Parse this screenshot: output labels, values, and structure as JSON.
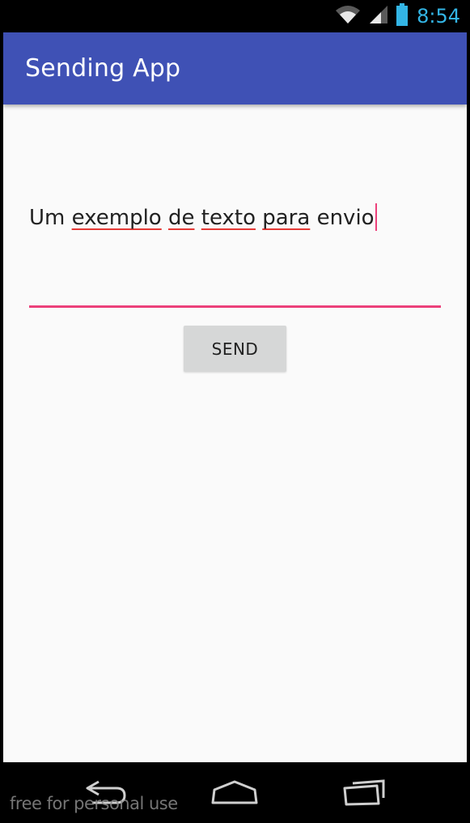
{
  "status_bar": {
    "time": "8:54",
    "icons": [
      "wifi-icon",
      "signal-icon",
      "battery-icon"
    ],
    "time_color": "#33b5e5"
  },
  "app_bar": {
    "title": "Sending App",
    "color": "#3f51b5"
  },
  "message_input": {
    "words": [
      {
        "text": "Um",
        "spell_flag": false
      },
      {
        "text": "exemplo",
        "spell_flag": true
      },
      {
        "text": "de",
        "spell_flag": true
      },
      {
        "text": "texto",
        "spell_flag": true
      },
      {
        "text": "para",
        "spell_flag": true
      },
      {
        "text": "envio",
        "spell_flag": false
      }
    ],
    "accent_color": "#ec407a"
  },
  "send_button": {
    "label": "SEND"
  },
  "nav_bar": {
    "buttons": [
      "back-icon",
      "home-icon",
      "recents-icon"
    ]
  },
  "watermark": {
    "text": "free for personal use"
  }
}
